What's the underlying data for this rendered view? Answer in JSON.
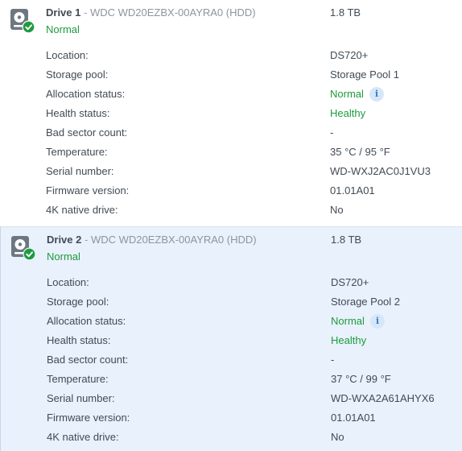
{
  "colors": {
    "status_green": "#1e9b3e",
    "selected_bg": "#e8f1fc",
    "info_blue": "#2f80d1"
  },
  "drives": [
    {
      "name": "Drive 1",
      "separator": "-",
      "model": "WDC WD20EZBX-00AYRA0 (HDD)",
      "capacity": "1.8 TB",
      "status": "Normal",
      "icon": "hdd-status-normal-icon",
      "details": {
        "location": {
          "label": "Location:",
          "value": "DS720+"
        },
        "storage_pool": {
          "label": "Storage pool:",
          "value": "Storage Pool 1"
        },
        "allocation_status": {
          "label": "Allocation status:",
          "value": "Normal"
        },
        "health_status": {
          "label": "Health status:",
          "value": "Healthy"
        },
        "bad_sector_count": {
          "label": "Bad sector count:",
          "value": "-"
        },
        "temperature": {
          "label": "Temperature:",
          "value": "35 °C / 95 °F"
        },
        "serial_number": {
          "label": "Serial number:",
          "value": "WD-WXJ2AC0J1VU3"
        },
        "firmware_version": {
          "label": "Firmware version:",
          "value": "01.01A01"
        },
        "native_4k": {
          "label": "4K native drive:",
          "value": "No"
        }
      }
    },
    {
      "name": "Drive 2",
      "separator": "-",
      "model": "WDC WD20EZBX-00AYRA0 (HDD)",
      "capacity": "1.8 TB",
      "status": "Normal",
      "icon": "hdd-status-normal-icon",
      "details": {
        "location": {
          "label": "Location:",
          "value": "DS720+"
        },
        "storage_pool": {
          "label": "Storage pool:",
          "value": "Storage Pool 2"
        },
        "allocation_status": {
          "label": "Allocation status:",
          "value": "Normal"
        },
        "health_status": {
          "label": "Health status:",
          "value": "Healthy"
        },
        "bad_sector_count": {
          "label": "Bad sector count:",
          "value": "-"
        },
        "temperature": {
          "label": "Temperature:",
          "value": "37 °C / 99 °F"
        },
        "serial_number": {
          "label": "Serial number:",
          "value": "WD-WXA2A61AHYX6"
        },
        "firmware_version": {
          "label": "Firmware version:",
          "value": "01.01A01"
        },
        "native_4k": {
          "label": "4K native drive:",
          "value": "No"
        }
      }
    }
  ],
  "info_icon_glyph": "i"
}
